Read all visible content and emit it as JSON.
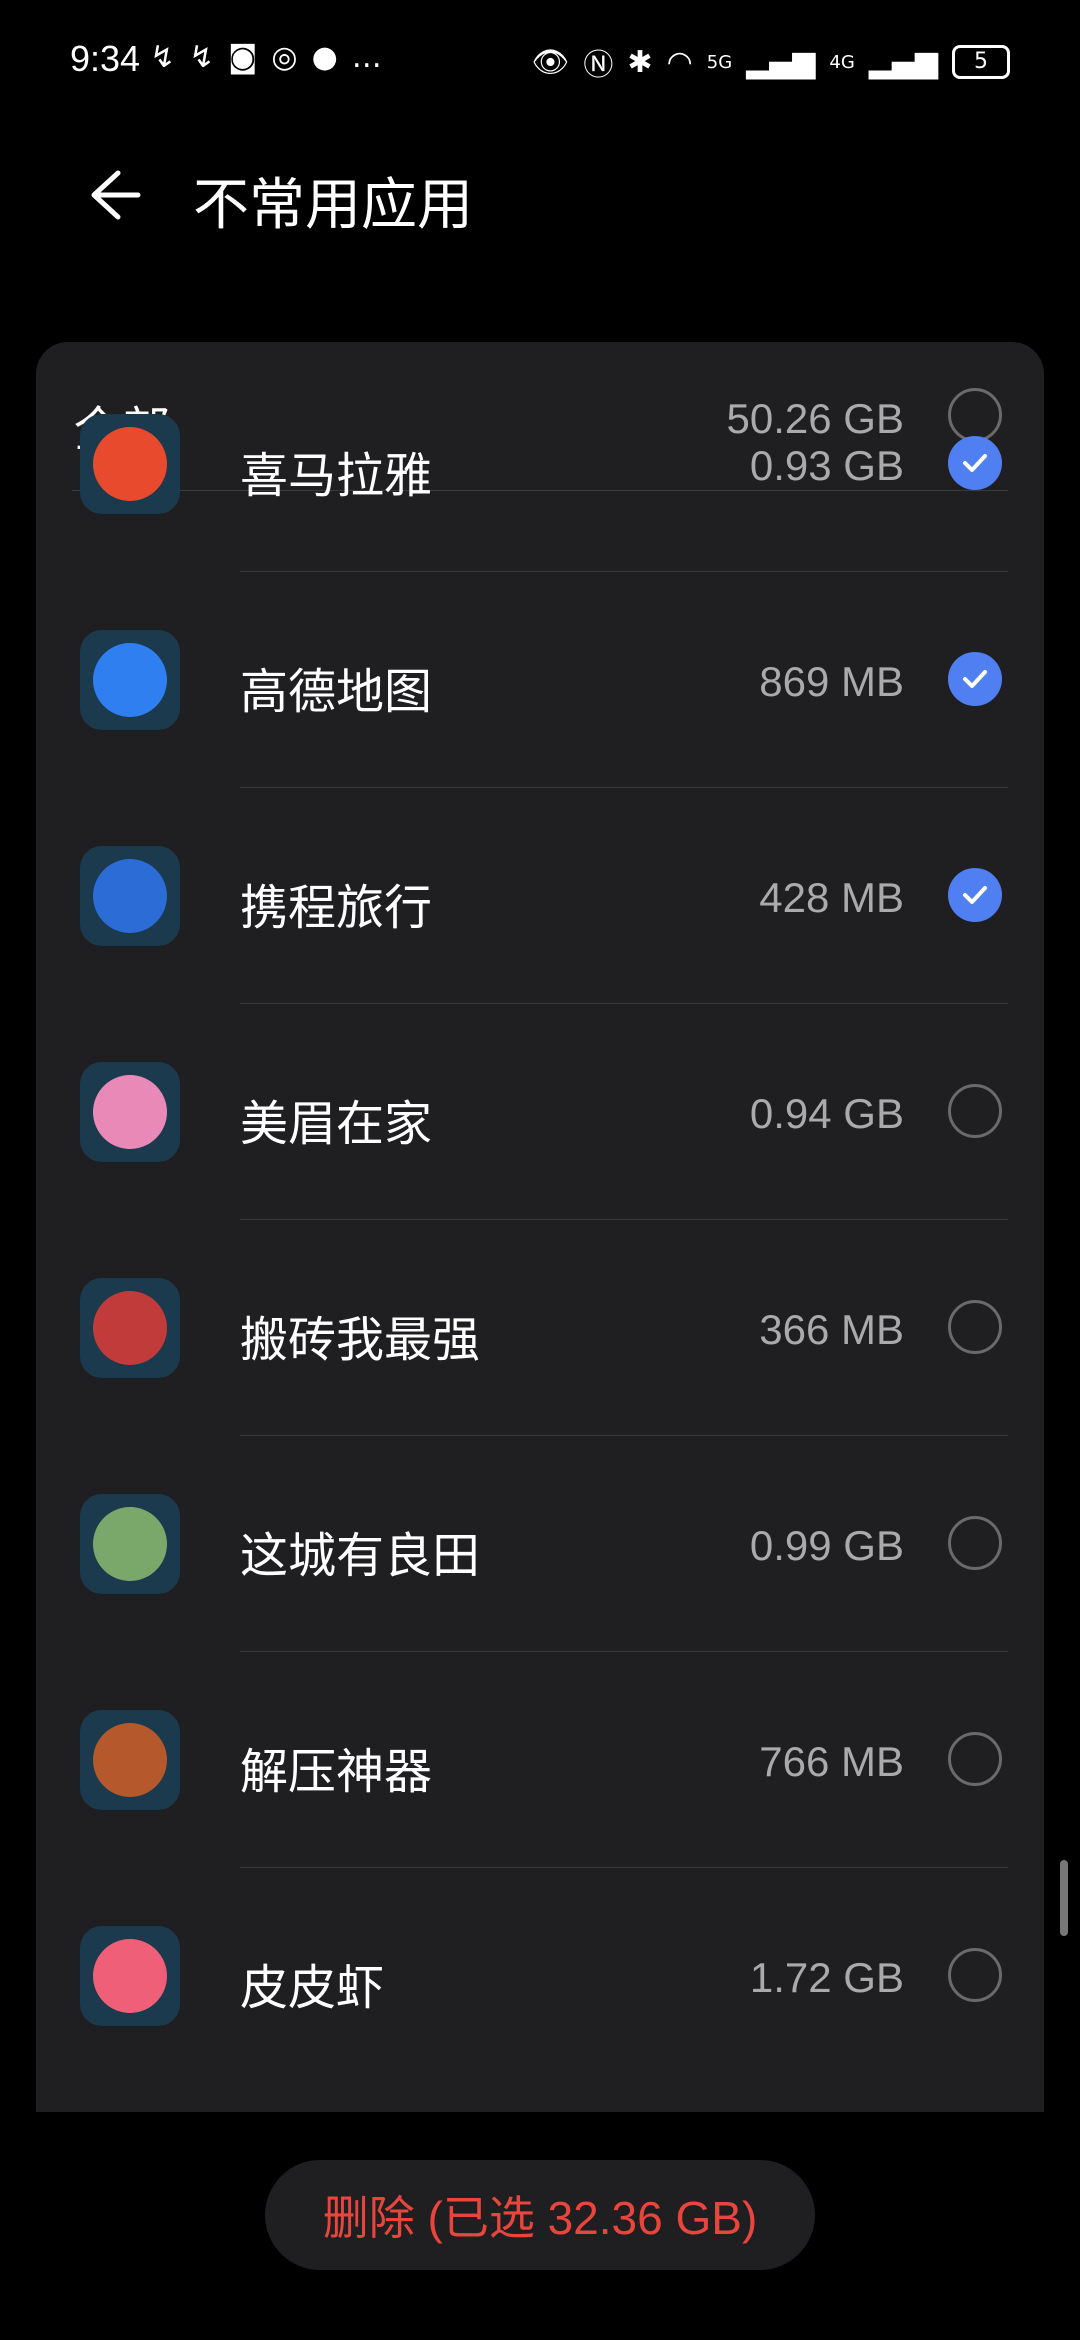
{
  "status_bar": {
    "time": "9:34",
    "battery": "5",
    "network_5g": "5G",
    "network_4g": "4G"
  },
  "header": {
    "title": "不常用应用"
  },
  "all_row": {
    "label": "全部",
    "size": "50.26 GB",
    "checked": false
  },
  "apps": [
    {
      "name": "喜马拉雅",
      "size": "0.93 GB",
      "checked": true,
      "icon": "ximalaya-icon",
      "icon_color": "#e84a2e"
    },
    {
      "name": "高德地图",
      "size": "869 MB",
      "checked": true,
      "icon": "amap-icon",
      "icon_color": "#2f7ff0"
    },
    {
      "name": "携程旅行",
      "size": "428 MB",
      "checked": true,
      "icon": "ctrip-icon",
      "icon_color": "#2b6cd6"
    },
    {
      "name": "美眉在家",
      "size": "0.94 GB",
      "checked": false,
      "icon": "meimei-icon",
      "icon_color": "#e889b8"
    },
    {
      "name": "搬砖我最强",
      "size": "366 MB",
      "checked": false,
      "icon": "banzhuan-icon",
      "icon_color": "#c23b3b"
    },
    {
      "name": "这城有良田",
      "size": "0.99 GB",
      "checked": false,
      "icon": "liangtian-icon",
      "icon_color": "#7aa86a"
    },
    {
      "name": "解压神器",
      "size": "766 MB",
      "checked": false,
      "icon": "antistress-icon",
      "icon_color": "#b5582c"
    },
    {
      "name": "皮皮虾",
      "size": "1.72 GB",
      "checked": false,
      "icon": "pipixia-icon",
      "icon_color": "#ef5f77"
    }
  ],
  "delete_button": {
    "label": "删除 (已选 32.36 GB)"
  },
  "colors": {
    "accent": "#4f7ff0",
    "danger": "#e8453c",
    "card": "#1f1f22",
    "background": "#000000"
  }
}
